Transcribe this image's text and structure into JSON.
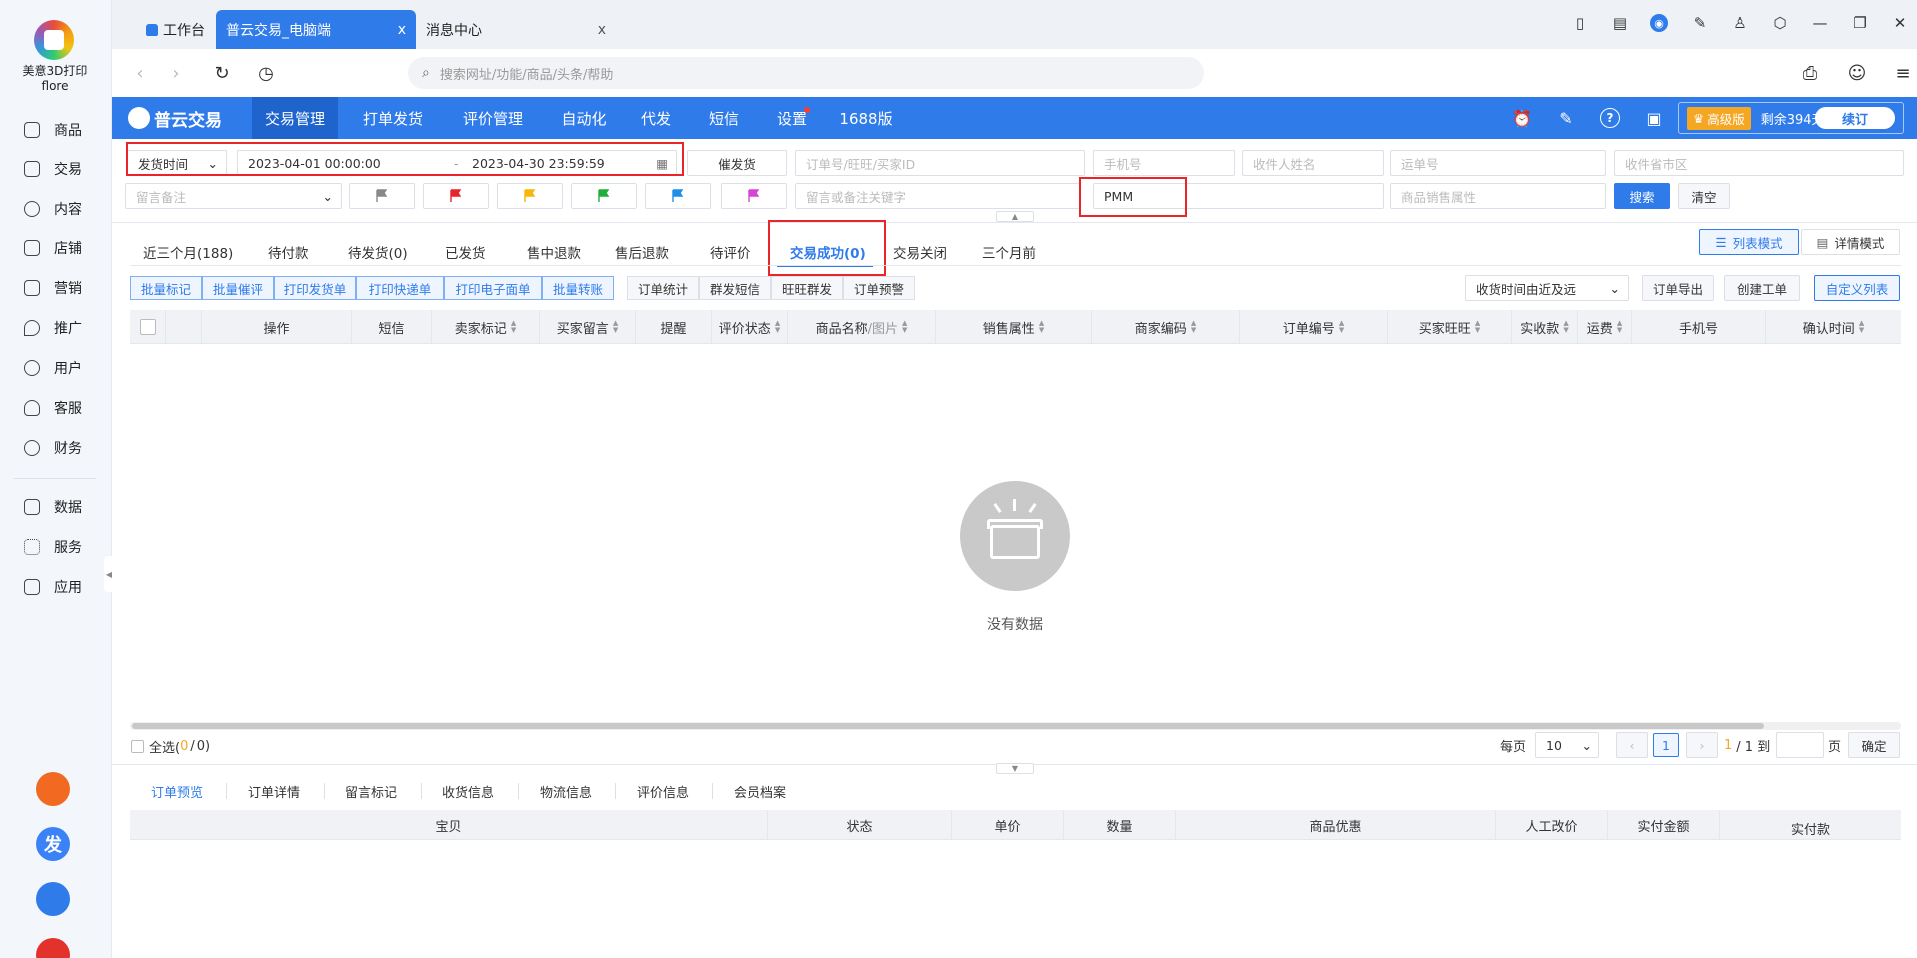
{
  "sidebar": {
    "brand_name": "美意3D打印\nflore",
    "items": [
      {
        "label": "商品",
        "icon": "product-icon"
      },
      {
        "label": "交易",
        "icon": "trade-icon"
      },
      {
        "label": "内容",
        "icon": "content-icon"
      },
      {
        "label": "店铺",
        "icon": "shop-icon"
      },
      {
        "label": "营销",
        "icon": "marketing-icon"
      },
      {
        "label": "推广",
        "icon": "promote-icon"
      },
      {
        "label": "用户",
        "icon": "user-icon"
      },
      {
        "label": "客服",
        "icon": "service-icon"
      },
      {
        "label": "财务",
        "icon": "finance-icon"
      },
      {
        "label": "数据",
        "icon": "data-icon"
      },
      {
        "label": "服务",
        "icon": "services-icon"
      },
      {
        "label": "应用",
        "icon": "apps-icon"
      }
    ],
    "apps": [
      {
        "label": "",
        "color": "#f26a21"
      },
      {
        "label": "发",
        "color": "#3b82f6"
      },
      {
        "label": "",
        "color": "#2f7bea"
      },
      {
        "label": "",
        "color": "#e2322b"
      }
    ]
  },
  "browser": {
    "tabs": [
      {
        "label": "工作台"
      },
      {
        "label": "普云交易_电脑端"
      },
      {
        "label": "消息中心"
      }
    ],
    "close_glyph": "x",
    "url_placeholder": "搜索网址/功能/商品/头条/帮助"
  },
  "app": {
    "logo_text": "普云交易",
    "menu": [
      "交易管理",
      "打单发货",
      "评价管理",
      "自动化",
      "代发",
      "短信",
      "设置",
      "1688版"
    ],
    "plan": {
      "label": "高级版",
      "remaining": "剩余394天",
      "renew": "续订"
    }
  },
  "filters": {
    "time_type": "发货时间",
    "start_time": "2023-04-01 00:00:00",
    "dash": "-",
    "end_time": "2023-04-30 23:59:59",
    "urge_label": "催发货",
    "order_placeholder": "订单号/旺旺/买家ID",
    "phone_placeholder": "手机号",
    "receiver_placeholder": "收件人姓名",
    "waybill_placeholder": "运单号",
    "region_placeholder": "收件省市区",
    "remark_placeholder": "留言备注",
    "flag_colors": [
      "#888888",
      "#e8262a",
      "#f5b70a",
      "#1fae3b",
      "#1e8ee8",
      "#d645d6"
    ],
    "keyword_placeholder": "留言或备注关键字",
    "product_value": "PMM",
    "sku_placeholder": "商品销售属性",
    "search_label": "搜索",
    "clear_label": "清空"
  },
  "status_tabs": [
    "近三个月(188)",
    "待付款",
    "待发货(0)",
    "已发货",
    "售中退款",
    "售后退款",
    "待评价",
    "交易成功(0)",
    "交易关闭",
    "三个月前"
  ],
  "view_modes": {
    "list": "列表模式",
    "detail": "详情模式"
  },
  "toolbar": {
    "batch": [
      "批量标记",
      "批量催评",
      "打印发货单",
      "打印快递单",
      "打印电子面单",
      "批量转账"
    ],
    "tools": [
      "订单统计",
      "群发短信",
      "旺旺群发",
      "订单预警"
    ],
    "sort_select": "收货时间由近及远",
    "export": "订单导出",
    "create_ticket": "创建工单",
    "custom_list": "自定义列表"
  },
  "table": {
    "columns": [
      "操作",
      "短信",
      "卖家标记",
      "买家留言",
      "提醒",
      "评价状态",
      "商品名称",
      "/图片",
      "销售属性",
      "商家编码",
      "订单编号",
      "买家旺旺",
      "实收款",
      "运费",
      "手机号",
      "确认时间"
    ]
  },
  "empty_text": "没有数据",
  "pager": {
    "select_all": "全选(",
    "selected": "0",
    "slash": "/",
    "total": "0",
    "close_paren": ")",
    "per_page_label": "每页",
    "per_page": "10",
    "current": "1",
    "page_info_current": "1",
    "page_info_total": "/ 1 到",
    "page_unit": "页",
    "confirm": "确定"
  },
  "bottom": {
    "tabs": [
      "订单预览",
      "订单详情",
      "留言标记",
      "收货信息",
      "物流信息",
      "评价信息",
      "会员档案"
    ],
    "columns": [
      "宝贝",
      "状态",
      "单价",
      "数量",
      "商品优惠",
      "人工改价",
      "实付金额",
      "实付款"
    ]
  },
  "colors": {
    "primary": "#2f7bea",
    "highlight": "#e8262a",
    "pager_current": "#f5a623"
  }
}
